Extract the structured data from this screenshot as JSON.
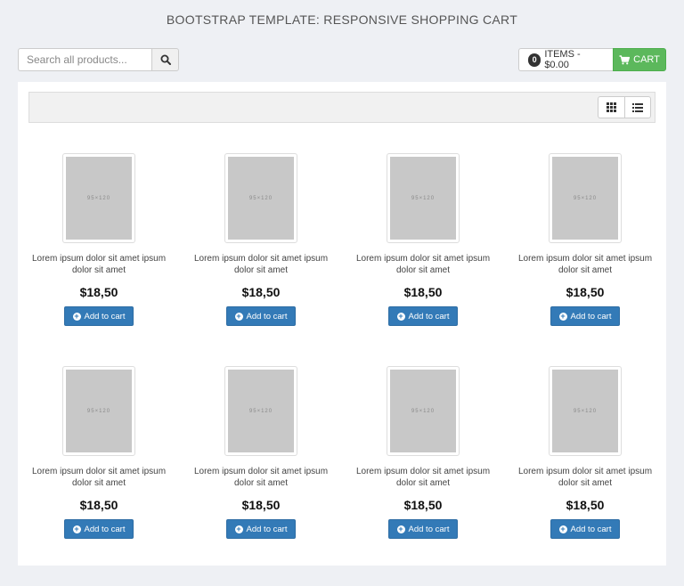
{
  "page": {
    "title": "BOOTSTRAP TEMPLATE: RESPONSIVE SHOPPING CART"
  },
  "search": {
    "placeholder": "Search all products...",
    "value": ""
  },
  "cart": {
    "count": "0",
    "items_label": "ITEMS - $0.00",
    "cart_label": "CART"
  },
  "colors": {
    "cart_button": "#5cb85c",
    "add_button": "#337ab7",
    "background": "#eef0f4"
  },
  "products": [
    {
      "image_label": "95×120",
      "name": "Lorem ipsum dolor sit amet ipsum dolor sit amet",
      "price": "$18,50",
      "button_label": "Add to cart"
    },
    {
      "image_label": "95×120",
      "name": "Lorem ipsum dolor sit amet ipsum dolor sit amet",
      "price": "$18,50",
      "button_label": "Add to cart"
    },
    {
      "image_label": "95×120",
      "name": "Lorem ipsum dolor sit amet ipsum dolor sit amet",
      "price": "$18,50",
      "button_label": "Add to cart"
    },
    {
      "image_label": "95×120",
      "name": "Lorem ipsum dolor sit amet ipsum dolor sit amet",
      "price": "$18,50",
      "button_label": "Add to cart"
    },
    {
      "image_label": "95×120",
      "name": "Lorem ipsum dolor sit amet ipsum dolor sit amet",
      "price": "$18,50",
      "button_label": "Add to cart"
    },
    {
      "image_label": "95×120",
      "name": "Lorem ipsum dolor sit amet ipsum dolor sit amet",
      "price": "$18,50",
      "button_label": "Add to cart"
    },
    {
      "image_label": "95×120",
      "name": "Lorem ipsum dolor sit amet ipsum dolor sit amet",
      "price": "$18,50",
      "button_label": "Add to cart"
    },
    {
      "image_label": "95×120",
      "name": "Lorem ipsum dolor sit amet ipsum dolor sit amet",
      "price": "$18,50",
      "button_label": "Add to cart"
    }
  ]
}
